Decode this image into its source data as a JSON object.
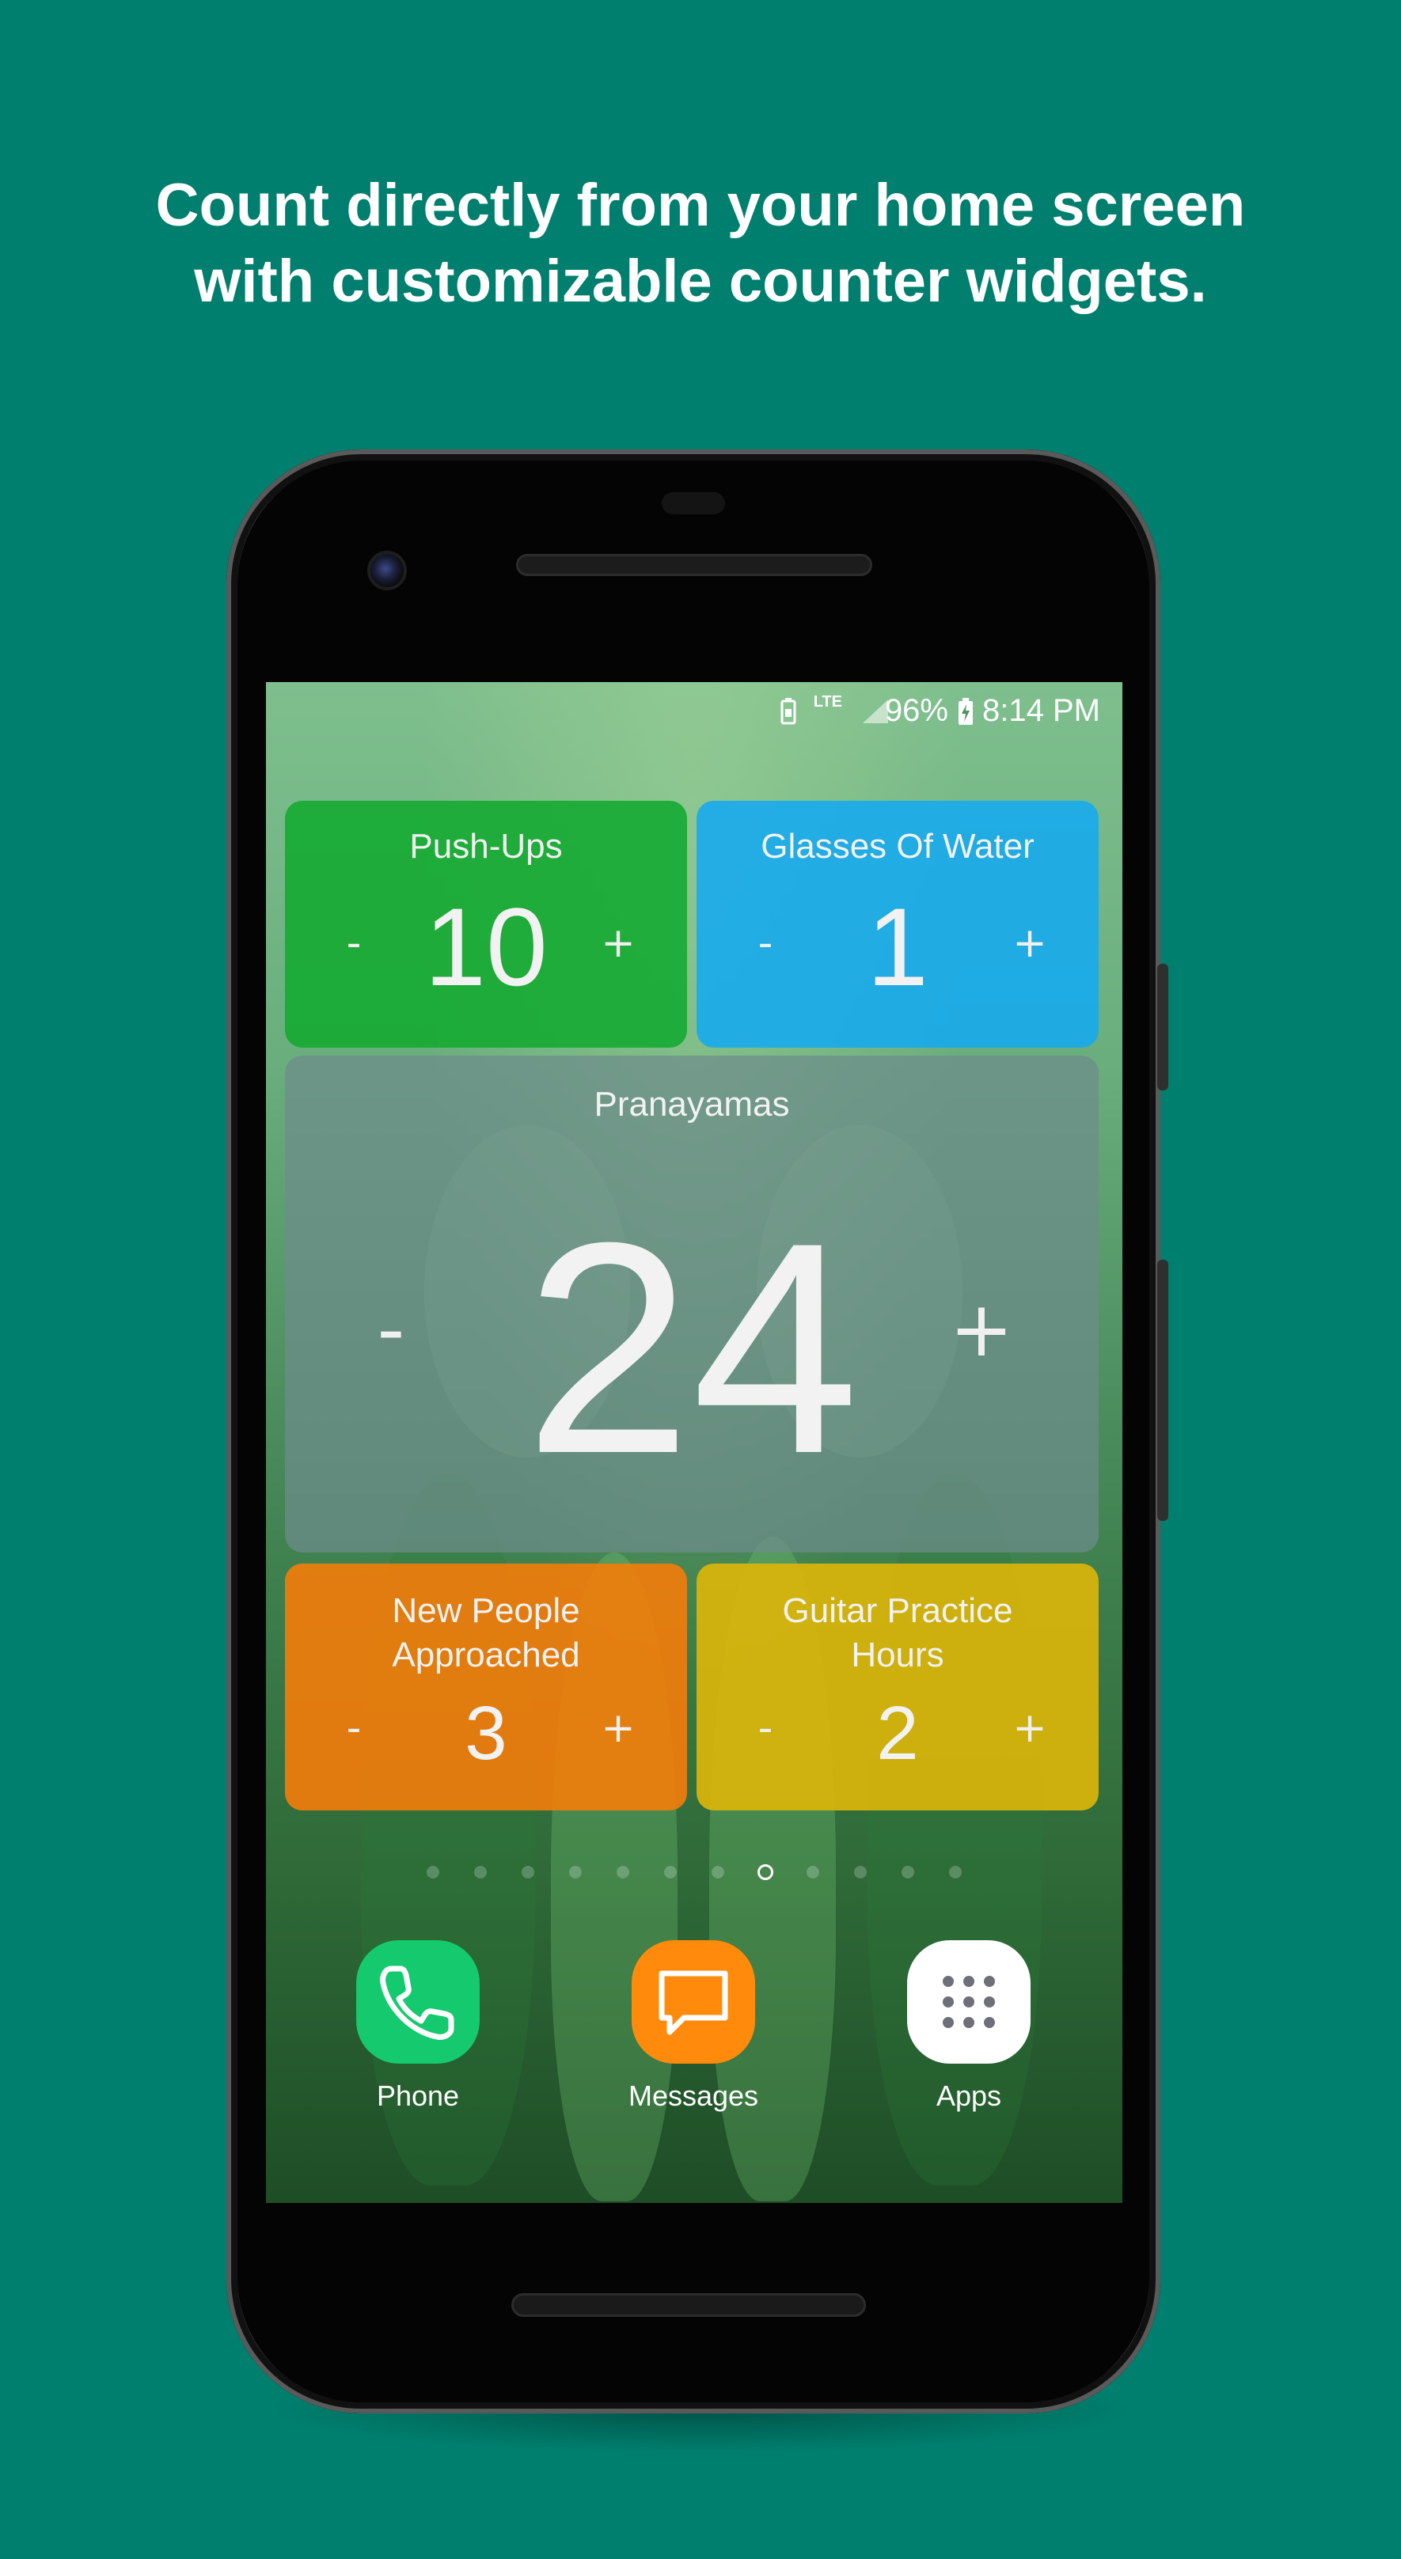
{
  "headline": {
    "line1": "Count directly from your home screen",
    "line2": "with customizable counter widgets."
  },
  "status_bar": {
    "network": "LTE",
    "battery_percent": "96%",
    "time": "8:14 PM"
  },
  "widgets": [
    {
      "title": "Push-Ups",
      "value": "10",
      "minus": "-",
      "plus": "+",
      "color": "#12aa30"
    },
    {
      "title": "Glasses Of Water",
      "value": "1",
      "minus": "-",
      "plus": "+",
      "color": "#14aaf0"
    },
    {
      "title": "Pranayamas",
      "value": "24",
      "minus": "-",
      "plus": "+",
      "color": "#6e8c8c"
    },
    {
      "title_line1": "New People",
      "title_line2": "Approached",
      "value": "3",
      "minus": "-",
      "plus": "+",
      "color": "#f47c0a"
    },
    {
      "title_line1": "Guitar Practice",
      "title_line2": "Hours",
      "value": "2",
      "minus": "-",
      "plus": "+",
      "color": "#deb608"
    }
  ],
  "page_indicator": {
    "count": 12,
    "active_index": 7
  },
  "dock": [
    {
      "label": "Phone",
      "icon": "phone-icon",
      "color": "#14c96e"
    },
    {
      "label": "Messages",
      "icon": "message-icon",
      "color": "#ff8a0c"
    },
    {
      "label": "Apps",
      "icon": "apps-grid-icon",
      "color": "#ffffff"
    }
  ],
  "colors": {
    "background": "#007f6e",
    "phone_body": "#050505"
  }
}
